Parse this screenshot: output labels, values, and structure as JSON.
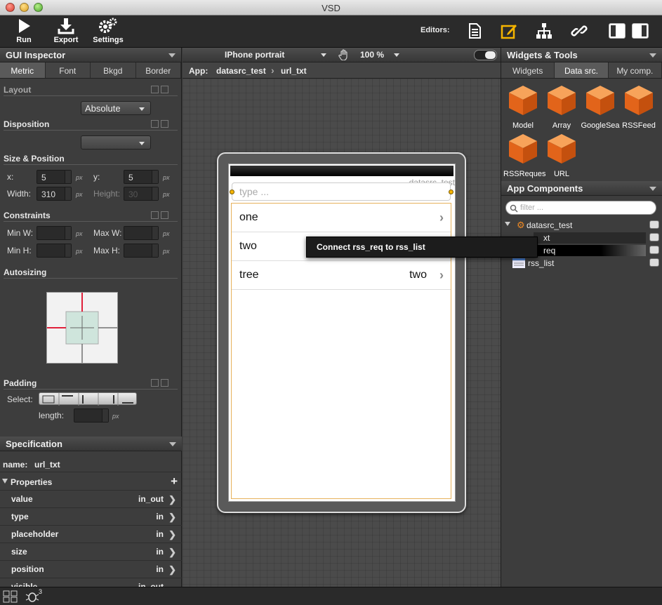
{
  "window": {
    "title": "VSD"
  },
  "toolbar": {
    "run_label": "Run",
    "export_label": "Export",
    "settings_label": "Settings",
    "editors_label": "Editors:"
  },
  "left": {
    "header": "GUI Inspector",
    "tabs": [
      "Metric",
      "Font",
      "Bkgd",
      "Border"
    ],
    "active_tab": "Metric",
    "layout": {
      "title": "Layout",
      "mode": "Absolute"
    },
    "disposition": {
      "title": "Disposition",
      "value": ""
    },
    "size_position": {
      "title": "Size & Position",
      "x_label": "x:",
      "x_value": "5",
      "y_label": "y:",
      "y_value": "5",
      "width_label": "Width:",
      "width_value": "310",
      "height_label": "Height:",
      "height_value": "30",
      "unit": "px"
    },
    "constraints": {
      "title": "Constraints",
      "min_w_label": "Min W:",
      "max_w_label": "Max W:",
      "min_h_label": "Min H:",
      "max_h_label": "Max H:",
      "unit": "px"
    },
    "autosizing": {
      "title": "Autosizing"
    },
    "padding": {
      "title": "Padding",
      "select_label": "Select:",
      "length_label": "length:",
      "unit": "px"
    },
    "specification": {
      "header": "Specification",
      "name_label": "name:",
      "name_value": "url_txt",
      "properties_label": "Properties",
      "add_symbol": "+",
      "properties": [
        {
          "key": "value",
          "val": "in_out"
        },
        {
          "key": "type",
          "val": "in"
        },
        {
          "key": "placeholder",
          "val": "in"
        },
        {
          "key": "size",
          "val": "in"
        },
        {
          "key": "position",
          "val": "in"
        },
        {
          "key": "visible",
          "val": "in_out"
        }
      ]
    }
  },
  "center": {
    "device": "IPhone portrait",
    "zoom": "100 %",
    "breadcrumb": {
      "app_label": "App:",
      "app": "datasrc_test",
      "item": "url_txt"
    },
    "mockup": {
      "datasource_label": "datasrc_test",
      "textfield_placeholder": "type ...",
      "rows": [
        {
          "title": "one",
          "detail": ""
        },
        {
          "title": "two",
          "detail": ""
        },
        {
          "title": "tree",
          "detail": "two"
        }
      ]
    },
    "tooltip": "Connect rss_req to rss_list"
  },
  "right": {
    "header": "Widgets & Tools",
    "tabs": [
      "Widgets",
      "Data src.",
      "My comp."
    ],
    "active_tab": "Data src.",
    "widgets": [
      "Model",
      "Array",
      "GoogleSea",
      "RSSFeed",
      "RSSReques",
      "URL"
    ],
    "components_header": "App Components",
    "filter_placeholder": "filter ...",
    "tree": {
      "root": "datasrc_test",
      "children": [
        "xt",
        "req",
        "rss_list"
      ]
    }
  },
  "bottombar": {
    "badge": "3"
  },
  "colors": {
    "accent": "#f5b400",
    "panel": "#3d3d3d",
    "canvas": "#4b4b4b"
  }
}
